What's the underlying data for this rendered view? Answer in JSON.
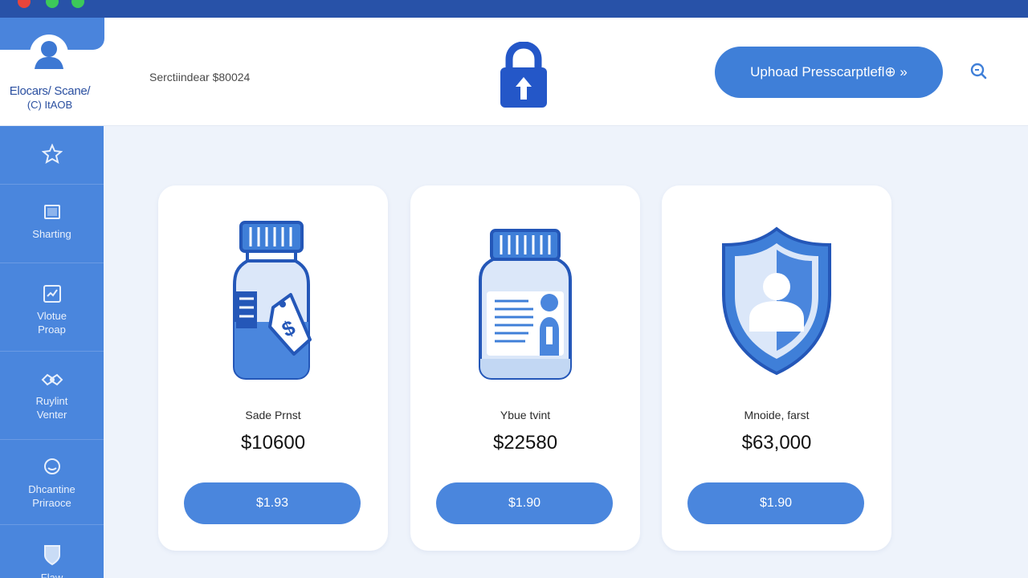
{
  "window": {
    "traffic_lights": [
      "close",
      "minimize",
      "maximize"
    ]
  },
  "profile": {
    "name": "Elocars/ Scane/",
    "sub": "(C) ItAOB",
    "icon": "user-avatar-icon"
  },
  "header": {
    "search_text": "Serctiindear $80024",
    "center_icon": "lock-upload-icon",
    "upload_label": "Uphoad Presscarptlefl⊕ »",
    "right_icon": "search-icon"
  },
  "sidebar": {
    "items": [
      {
        "label": "",
        "icon": "star-badge-icon"
      },
      {
        "label": "Sharting",
        "icon": "screen-icon"
      },
      {
        "label": "Vlotue\nProap",
        "icon": "clipboard-icon"
      },
      {
        "label": "Ruylint\nVenter",
        "icon": "handshake-icon"
      },
      {
        "label": "Dhcantine\nPriraoce",
        "icon": "bubble-icon"
      },
      {
        "label": "Flaw",
        "icon": "shield-icon"
      }
    ]
  },
  "cards": [
    {
      "label": "Sade Prnst",
      "price": "$10600",
      "button": "$1.93",
      "icon": "pill-bottle-price-tag-icon"
    },
    {
      "label": "Ybue tvint",
      "price": "$22580",
      "button": "$1.90",
      "icon": "pill-bottle-label-icon"
    },
    {
      "label": "Mnoide, farst",
      "price": "$63,000",
      "button": "$1.90",
      "icon": "shield-user-icon"
    }
  ],
  "colors": {
    "accent": "#4a86dd",
    "accent_dark": "#2457b8",
    "titlebar": "#2852a8",
    "background": "#eef3fb"
  }
}
